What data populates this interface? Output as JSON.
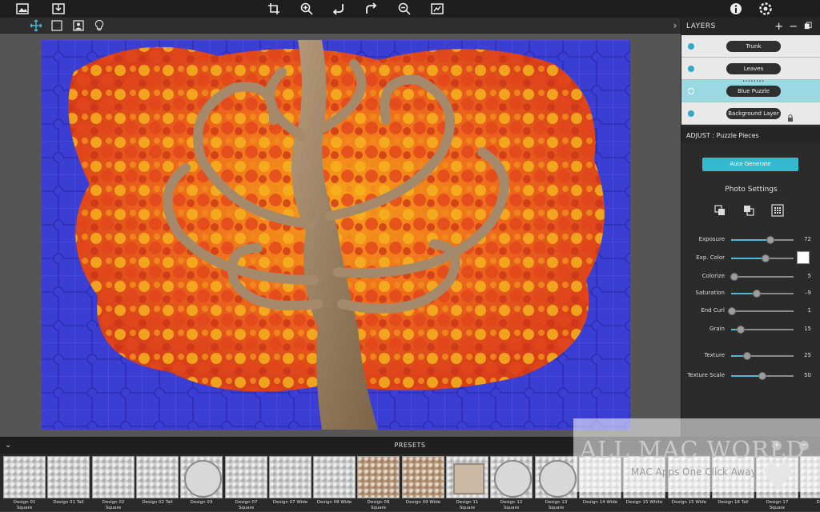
{
  "toolbar": {
    "icons": [
      "image-icon",
      "save-icon",
      "crop-icon",
      "zoom-in-icon",
      "undo-icon",
      "redo-icon",
      "zoom-out-icon",
      "fit-to-screen-icon",
      "info-icon",
      "settings-icon"
    ]
  },
  "tools": [
    "move-tool-icon",
    "select-tool-icon",
    "portrait-tool-icon",
    "lightbulb-icon"
  ],
  "layers": {
    "header": "LAYERS",
    "add_label": "+",
    "remove_label": "−",
    "items": [
      {
        "label": "Trunk"
      },
      {
        "label": "Leaves"
      },
      {
        "label": "Blue Puzzle",
        "dots": "••••••••",
        "selected": true
      },
      {
        "label": "Background Layer",
        "locked": true
      }
    ]
  },
  "adjust": {
    "header": "ADJUST : Puzzle Pieces",
    "auto_generate_label": "Auto Generate",
    "photo_settings_label": "Photo Settings",
    "sliders": [
      {
        "label": "Exposure",
        "value": "72",
        "position": 0.63
      },
      {
        "label": "Exp. Color",
        "value": "",
        "position": 0.55,
        "swatch": "#ffffff"
      },
      {
        "label": "Colorize",
        "value": "5",
        "position": 0.05
      },
      {
        "label": "Saturation",
        "value": "–9",
        "position": 0.41
      },
      {
        "label": "End Curl",
        "value": "1",
        "position": 0.01
      },
      {
        "label": "Grain",
        "value": "15",
        "position": 0.15
      },
      {
        "label": "Texture",
        "value": "25",
        "position": 0.25
      },
      {
        "label": "Texture Scale",
        "value": "50",
        "position": 0.5
      }
    ]
  },
  "presets": {
    "header": "PRESETS",
    "toggle": "⌄",
    "add_label": "+",
    "remove_label": "−",
    "items": [
      {
        "line1": "Design 01",
        "line2": "Square",
        "style": ""
      },
      {
        "line1": "Design 01 Tall",
        "line2": "",
        "style": ""
      },
      {
        "line1": "Design 02",
        "line2": "Square",
        "style": ""
      },
      {
        "line1": "Design 02 Tall",
        "line2": "",
        "style": ""
      },
      {
        "line1": "Design 03",
        "line2": "",
        "style": "round"
      },
      {
        "line1": "Design 07",
        "line2": "Square",
        "style": ""
      },
      {
        "line1": "Design 07 Wide",
        "line2": "",
        "style": ""
      },
      {
        "line1": "Design 08 Wide",
        "line2": "",
        "style": ""
      },
      {
        "line1": "Design 09",
        "line2": "Square",
        "style": "tan"
      },
      {
        "line1": "Design 09 Wide",
        "line2": "",
        "style": "tan"
      },
      {
        "line1": "Design 11",
        "line2": "Square",
        "style": "frame"
      },
      {
        "line1": "Design 12",
        "line2": "Square",
        "style": "round"
      },
      {
        "line1": "Design 13",
        "line2": "Square",
        "style": "round"
      },
      {
        "line1": "Design 14 Wide",
        "line2": "",
        "style": ""
      },
      {
        "line1": "Design 15 White",
        "line2": "",
        "style": ""
      },
      {
        "line1": "Design 15 Wide",
        "line2": "",
        "style": ""
      },
      {
        "line1": "Design 16 Tall",
        "line2": "",
        "style": ""
      },
      {
        "line1": "Design 17",
        "line2": "Square",
        "style": "heart"
      },
      {
        "line1": "Desi",
        "line2": "",
        "style": ""
      }
    ]
  },
  "watermark": {
    "title": "ALL MAC WORLD",
    "subtitle": "MAC Apps One Click Away"
  },
  "colors": {
    "accent": "#35b8d0",
    "canvas_bg": "#555555",
    "puzzle_blue": "#3b3fd0"
  }
}
